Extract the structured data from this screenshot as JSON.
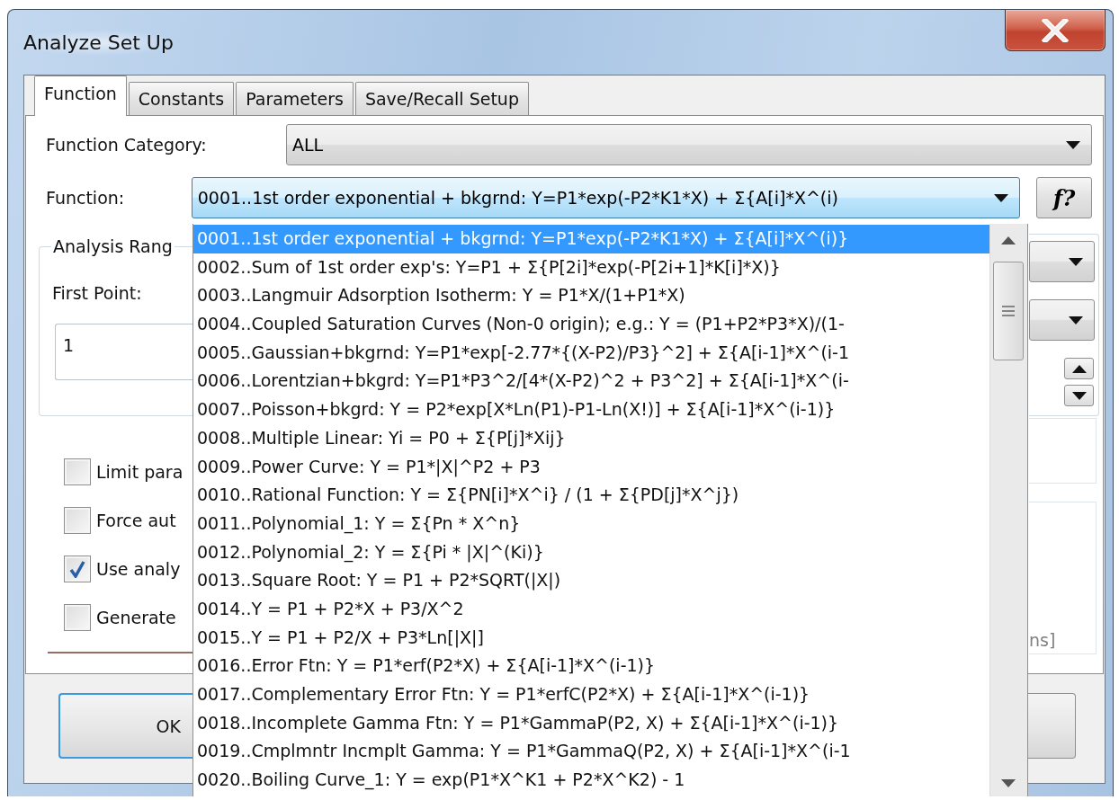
{
  "window": {
    "title": "Analyze Set Up"
  },
  "tabs": [
    {
      "label": "Function",
      "selected": true
    },
    {
      "label": "Constants",
      "selected": false
    },
    {
      "label": "Parameters",
      "selected": false
    },
    {
      "label": "Save/Recall Setup",
      "selected": false
    }
  ],
  "function_category": {
    "label": "Function Category:",
    "value": "ALL",
    "focused": false
  },
  "function": {
    "label": "Function:",
    "value": "0001..1st order exponential + bkgrnd: Y=P1*exp(-P2*K1*X) + Σ{A[i]*X^(i)",
    "focused": true,
    "help_button": "f?"
  },
  "analysis_range": {
    "title": "Analysis Rang",
    "first_point_label": "First Point:",
    "first_point": "1"
  },
  "options": [
    {
      "label": "Limit para",
      "checked": false
    },
    {
      "label": "Force aut",
      "checked": false
    },
    {
      "label": "Use analy",
      "checked": true
    },
    {
      "label": "Generate",
      "checked": false
    }
  ],
  "side_panel_text": "ns]",
  "ok_button": "OK",
  "function_list": [
    {
      "label": "0001..1st order exponential + bkgrnd: Y=P1*exp(-P2*K1*X) + Σ{A[i]*X^(i)}",
      "selected": true
    },
    {
      "label": "0002..Sum of 1st order exp's: Y=P1 + Σ{P[2i]*exp(-P[2i+1]*K[i]*X)}",
      "selected": false
    },
    {
      "label": "0003..Langmuir Adsorption Isotherm: Y = P1*X/(1+P1*X)",
      "selected": false
    },
    {
      "label": "0004..Coupled Saturation Curves (Non-0 origin); e.g.: Y = (P1+P2*P3*X)/(1-",
      "selected": false
    },
    {
      "label": "0005..Gaussian+bkgrnd: Y=P1*exp[-2.77*{(X-P2)/P3}^2] + Σ{A[i-1]*X^(i-1",
      "selected": false
    },
    {
      "label": "0006..Lorentzian+bkgrd: Y=P1*P3^2/[4*(X-P2)^2 + P3^2] + Σ{A[i-1]*X^(i-",
      "selected": false
    },
    {
      "label": "0007..Poisson+bkgrd: Y = P2*exp[X*Ln(P1)-P1-Ln(X!)] + Σ{A[i-1]*X^(i-1)}",
      "selected": false
    },
    {
      "label": "0008..Multiple Linear: Yi = P0 + Σ{P[j]*Xij}",
      "selected": false
    },
    {
      "label": "0009..Power Curve: Y = P1*|X|^P2 + P3",
      "selected": false
    },
    {
      "label": "0010..Rational Function: Y = Σ{PN[i]*X^i} / (1 + Σ{PD[j]*X^j})",
      "selected": false
    },
    {
      "label": "0011..Polynomial_1: Y = Σ{Pn * X^n}",
      "selected": false
    },
    {
      "label": "0012..Polynomial_2: Y = Σ{Pi * |X|^(Ki)}",
      "selected": false
    },
    {
      "label": "0013..Square Root: Y = P1 + P2*SQRT(|X|)",
      "selected": false
    },
    {
      "label": "0014..Y = P1 + P2*X + P3/X^2",
      "selected": false
    },
    {
      "label": "0015..Y = P1 + P2/X + P3*Ln[|X|]",
      "selected": false
    },
    {
      "label": "0016..Error Ftn: Y = P1*erf(P2*X)  + Σ{A[i-1]*X^(i-1)}",
      "selected": false
    },
    {
      "label": "0017..Complementary Error Ftn: Y = P1*erfC(P2*X) + Σ{A[i-1]*X^(i-1)}",
      "selected": false
    },
    {
      "label": "0018..Incomplete Gamma Ftn: Y = P1*GammaP(P2, X) + Σ{A[i-1]*X^(i-1)}",
      "selected": false
    },
    {
      "label": "0019..Cmplmntr Incmplt Gamma: Y = P1*GammaQ(P2, X) + Σ{A[i-1]*X^(i-1",
      "selected": false
    },
    {
      "label": "0020..Boiling Curve_1: Y = exp(P1*X^K1 + P2*X^K2) - 1",
      "selected": false
    }
  ]
}
